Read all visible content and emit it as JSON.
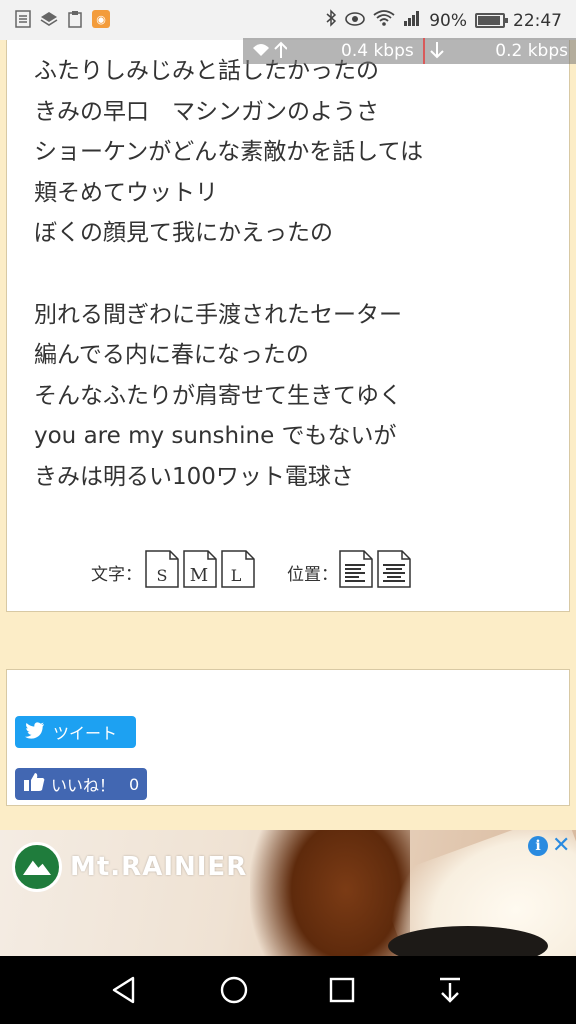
{
  "status_bar": {
    "left_icons": [
      "list-icon",
      "layers-icon",
      "clipboard-icon",
      "rss-icon"
    ],
    "right_icons": [
      "bluetooth-icon",
      "eye-icon",
      "wifi-icon",
      "signal-icon"
    ],
    "battery_percent": "90%",
    "battery_level": 0.9,
    "time": "22:47"
  },
  "network_speed": {
    "up_value": "0.4 kbps",
    "down_value": "0.2 kbps"
  },
  "lyrics": [
    "ふたりしみじみと話したかったの",
    "きみの早口　マシンガンのようさ",
    "ショーケンがどんな素敵かを話しては",
    "頬そめてウットリ",
    "ぼくの顔見て我にかえったの",
    "",
    "別れる間ぎわに手渡されたセーター",
    "編んでる内に春になったの",
    "そんなふたりが肩寄せて生きてゆく",
    "you are my sunshine でもないが",
    "きみは明るい100ワット電球さ"
  ],
  "controls": {
    "font_size_label": "文字：",
    "font_sizes": [
      "S",
      "M",
      "L"
    ],
    "position_label": "位置："
  },
  "share": {
    "tweet_label": "ツイート",
    "like_label": "いいね！",
    "like_count": "0"
  },
  "ad": {
    "brand": "Mt.RAINIER",
    "info_icon": "info-icon",
    "close_icon": "close-icon"
  },
  "navbar": {
    "buttons": [
      "back-icon",
      "home-icon",
      "recents-icon",
      "notification-pull-icon"
    ]
  }
}
